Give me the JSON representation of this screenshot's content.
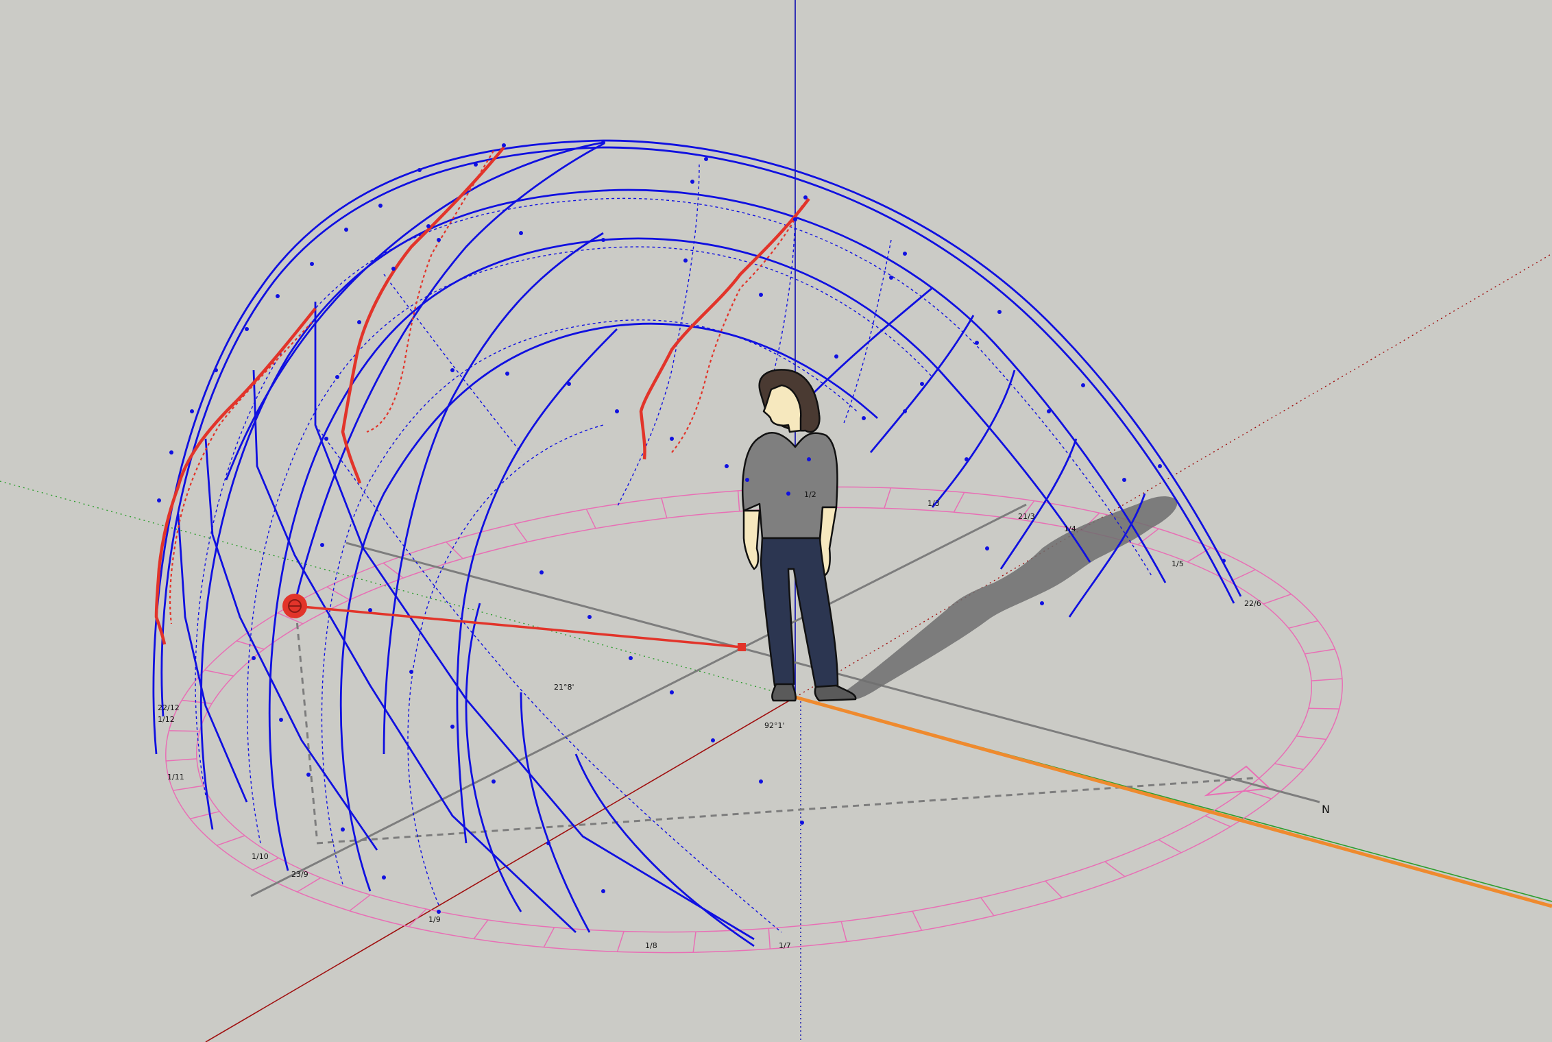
{
  "app": {
    "name": "3D modeling viewport"
  },
  "colors": {
    "background": "#cbcbc6",
    "sunpath_blue": "#1010e0",
    "analemma_red": "#e2342a",
    "ground_pink": "#e86fb5",
    "axis_red": "#a01010",
    "axis_green": "#2e9e2e",
    "axis_blue": "#0a0ab0",
    "north_orange": "#ef8a2e",
    "guide_gray": "#7d7d7d"
  },
  "icons": {
    "sun_marker": "sun-marker-icon",
    "north_arrow": "north-arrow-icon",
    "figure": "human-scale-figure"
  },
  "scene": {
    "north_label": "N",
    "angle_altitude": "21°8'",
    "angle_azimuth": "92°1'",
    "hour_labels": [
      {
        "id": "l1",
        "text": "1/2"
      },
      {
        "id": "l2",
        "text": "1/3"
      },
      {
        "id": "l3",
        "text": "21/3"
      },
      {
        "id": "l4",
        "text": "1/4"
      },
      {
        "id": "l5",
        "text": "1/5"
      },
      {
        "id": "l6",
        "text": "22/6"
      },
      {
        "id": "l7",
        "text": "1/7"
      },
      {
        "id": "l8",
        "text": "1/8"
      },
      {
        "id": "l9",
        "text": "1/9"
      },
      {
        "id": "l10",
        "text": "1/10"
      },
      {
        "id": "l11",
        "text": "23/9"
      },
      {
        "id": "l12",
        "text": "1/11"
      },
      {
        "id": "l13",
        "text": "1/12"
      },
      {
        "id": "l14",
        "text": "22/12"
      }
    ]
  }
}
